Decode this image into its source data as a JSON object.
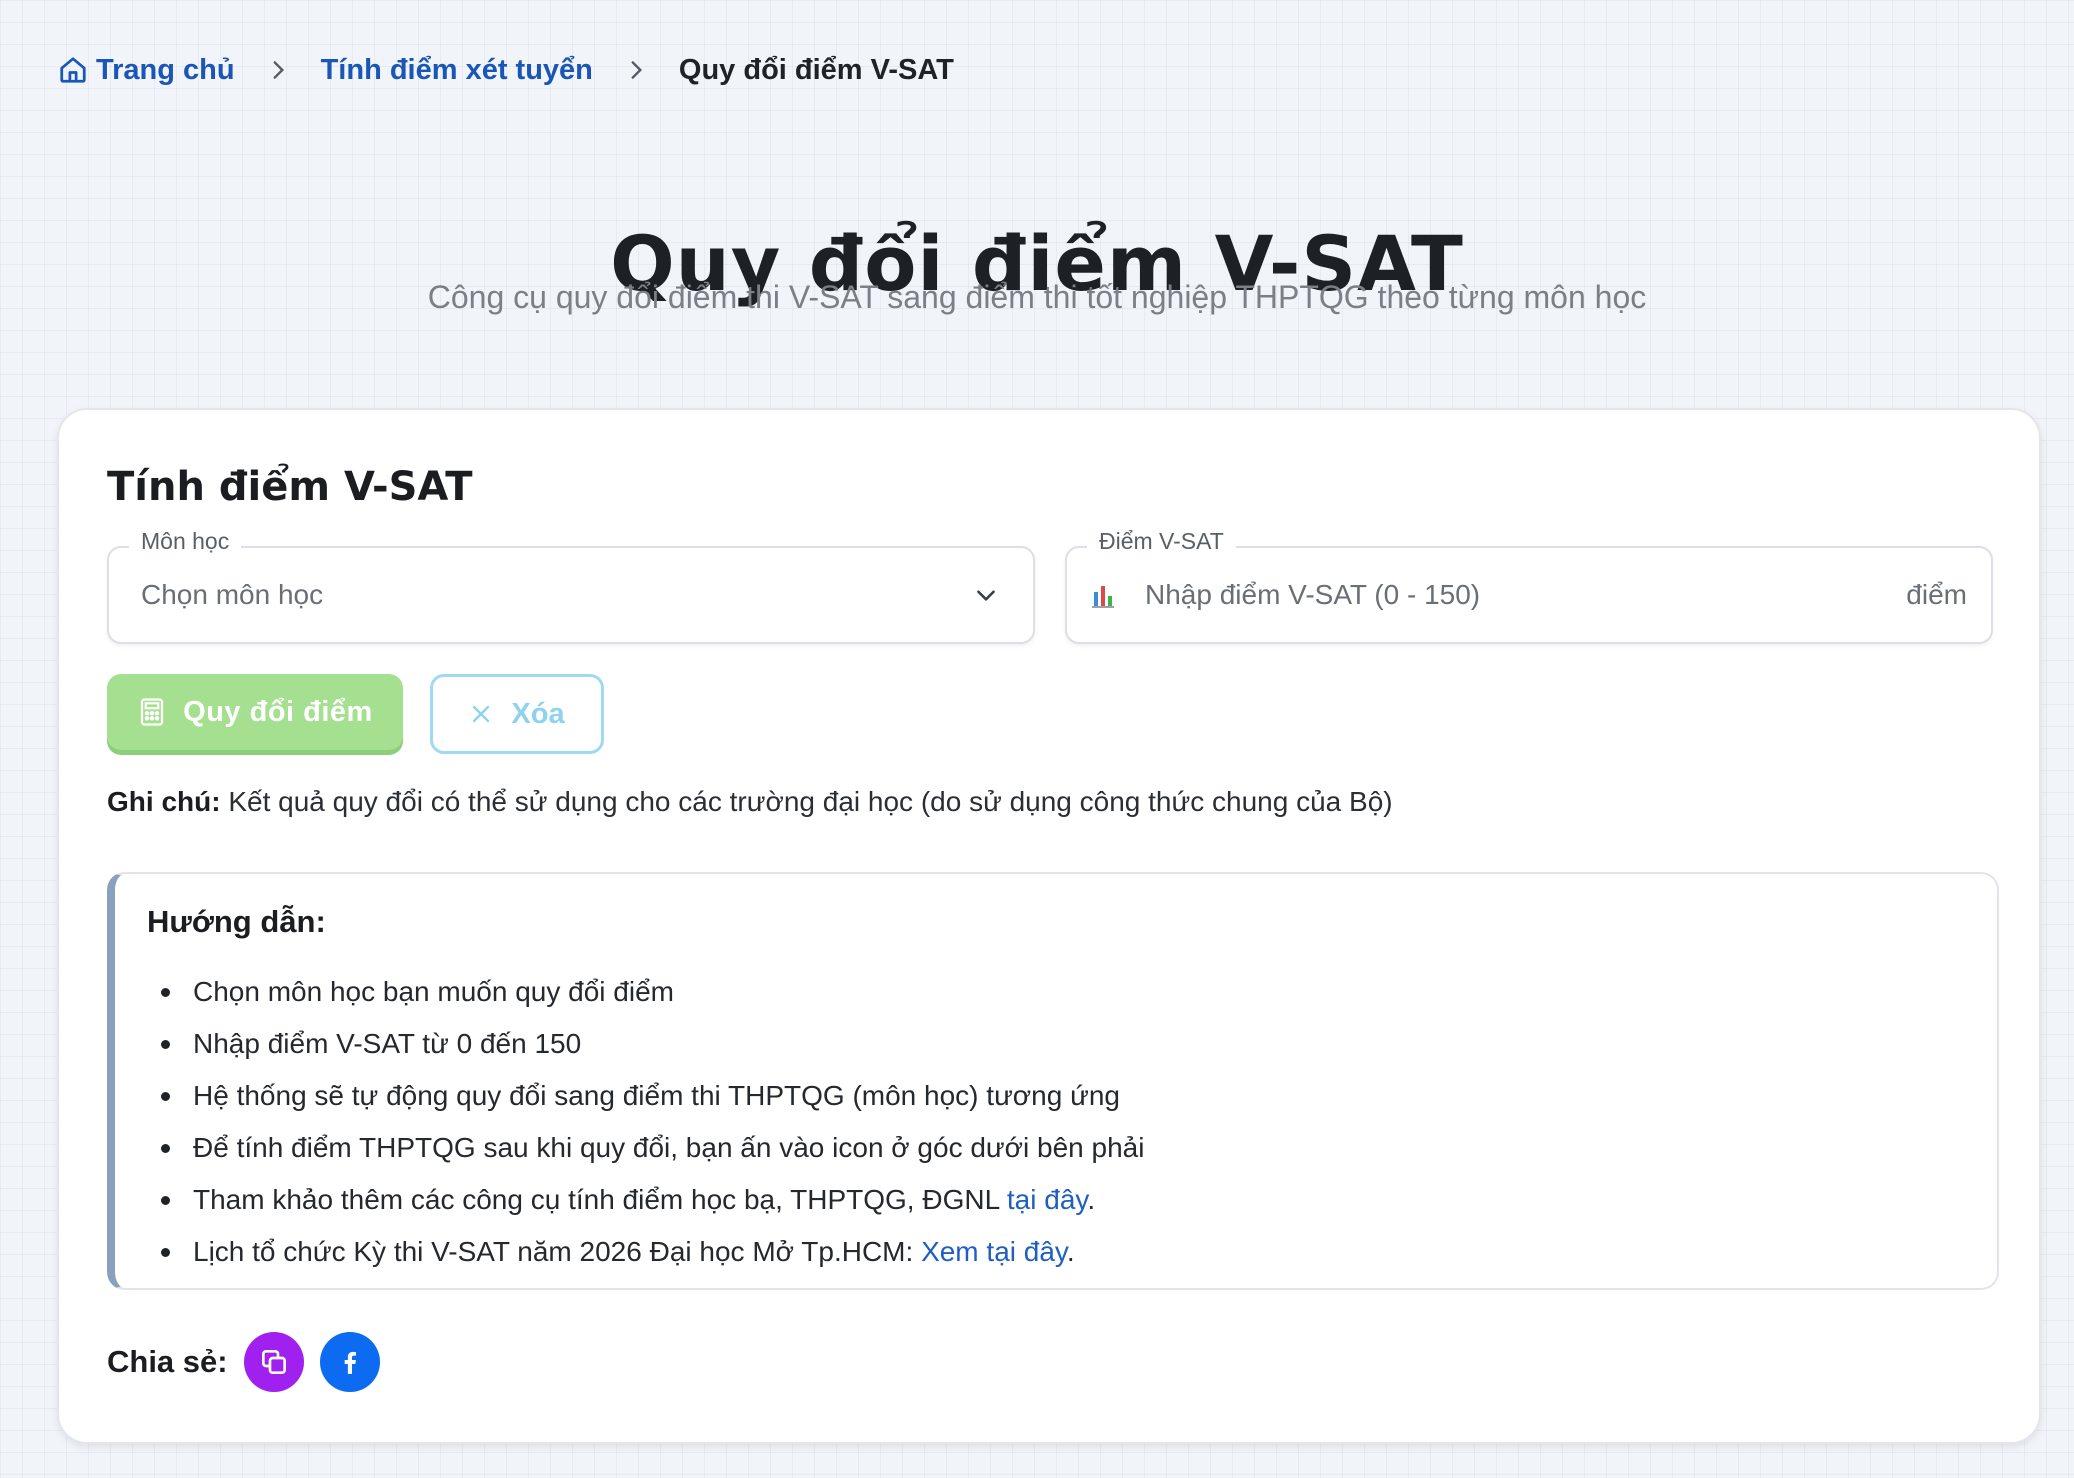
{
  "breadcrumb": {
    "home": "Trang chủ",
    "parent": "Tính điểm xét tuyển",
    "current": "Quy đổi điểm V-SAT"
  },
  "header": {
    "title": "Quy đổi điểm V-SAT",
    "subtitle": "Công cụ quy đổi điểm thi V-SAT sang điểm thi tốt nghiệp THPTQG theo từng môn học"
  },
  "form": {
    "title": "Tính điểm V-SAT",
    "subject": {
      "label": "Môn học",
      "placeholder": "Chọn môn học"
    },
    "score": {
      "label": "Điểm V-SAT",
      "placeholder": "Nhập điểm V-SAT (0 - 150)",
      "unit": "điểm"
    },
    "convert_button": "Quy đổi điểm",
    "clear_button": "Xóa",
    "note_label": "Ghi chú:",
    "note_text": " Kết quả quy đổi có thể sử dụng cho các trường đại học (do sử dụng công thức chung của Bộ)"
  },
  "guide": {
    "title": "Hướng dẫn:",
    "items": [
      "Chọn môn học bạn muốn quy đổi điểm",
      "Nhập điểm V-SAT từ 0 đến 150",
      "Hệ thống sẽ tự động quy đổi sang điểm thi THPTQG (môn học) tương ứng",
      "Để tính điểm THPTQG sau khi quy đổi, bạn ấn vào icon ở góc dưới bên phải"
    ],
    "item5_text": "Tham khảo thêm các công cụ tính điểm học bạ, THPTQG, ĐGNL ",
    "item5_link": "tại đây",
    "item6_text": "Lịch tổ chức Kỳ thi V-SAT năm 2026 Đại học Mở Tp.HCM: ",
    "item6_link": "Xem tại đây",
    "period": "."
  },
  "share": {
    "label": "Chia sẻ:",
    "copy_icon": "copy-icon",
    "facebook_icon": "facebook-icon"
  },
  "colors": {
    "link": "#1f5fc0",
    "convert_button": "#a4e08f",
    "clear_border": "#9fd9f2",
    "copy_button": "#a020ef",
    "facebook_button": "#0c6bf0"
  }
}
